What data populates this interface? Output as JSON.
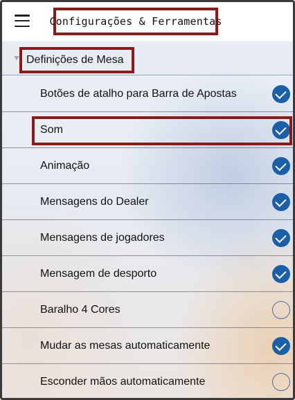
{
  "header": {
    "title": "Configurações & Ferramentas"
  },
  "section": {
    "label": "Definições de Mesa"
  },
  "colors": {
    "accent": "#1a5fa8",
    "highlight_border": "#8b1a1a"
  },
  "icons": {
    "menu": "hamburger-menu-icon",
    "expand": "caret-down-icon",
    "checked": "check-circle-icon",
    "unchecked": "empty-circle-icon"
  },
  "settings": [
    {
      "label": "Botões de atalho para Barra de Apostas",
      "checked": true
    },
    {
      "label": "Som",
      "checked": true
    },
    {
      "label": "Animação",
      "checked": true
    },
    {
      "label": "Mensagens do Dealer",
      "checked": true
    },
    {
      "label": "Mensagens de jogadores",
      "checked": true
    },
    {
      "label": "Mensagem de desporto",
      "checked": true
    },
    {
      "label": "Baralho 4 Cores",
      "checked": false
    },
    {
      "label": "Mudar as mesas automaticamente",
      "checked": true
    },
    {
      "label": "Esconder mãos automaticamente",
      "checked": false
    }
  ]
}
